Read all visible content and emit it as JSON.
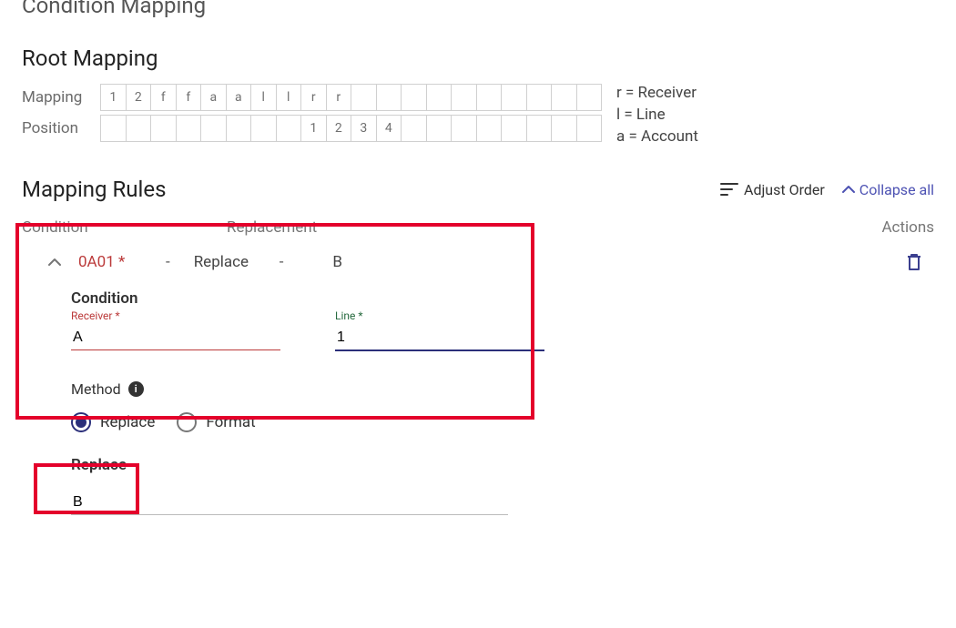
{
  "header_partially_visible": "Condition Mapping",
  "root_mapping": {
    "title": "Root Mapping",
    "mapping_label": "Mapping",
    "position_label": "Position",
    "mapping": [
      "1",
      "2",
      "f",
      "f",
      "a",
      "a",
      "l",
      "l",
      "r",
      "r",
      "",
      "",
      "",
      "",
      "",
      "",
      "",
      "",
      "",
      ""
    ],
    "position": [
      "",
      "",
      "",
      "",
      "",
      "",
      "",
      "",
      "1",
      "2",
      "3",
      "4",
      "",
      "",
      "",
      "",
      "",
      "",
      "",
      ""
    ],
    "legend": {
      "r": "r = Receiver",
      "l": "l = Line",
      "a": "a = Account"
    }
  },
  "rules": {
    "title": "Mapping Rules",
    "adjust_order": "Adjust Order",
    "collapse_all": "Collapse all",
    "columns": {
      "condition": "Condition",
      "replacement": "Replacement",
      "actions": "Actions"
    },
    "row": {
      "condition_code": "0A01 *",
      "method_word": "Replace",
      "value": "B"
    }
  },
  "editor": {
    "title": "Condition",
    "receiver_label": "Receiver",
    "receiver_value": "A",
    "line_label": "Line",
    "line_value": "1"
  },
  "method": {
    "label": "Method",
    "replace": "Replace",
    "format": "Format"
  },
  "replace": {
    "title": "Replace",
    "value": "B"
  }
}
